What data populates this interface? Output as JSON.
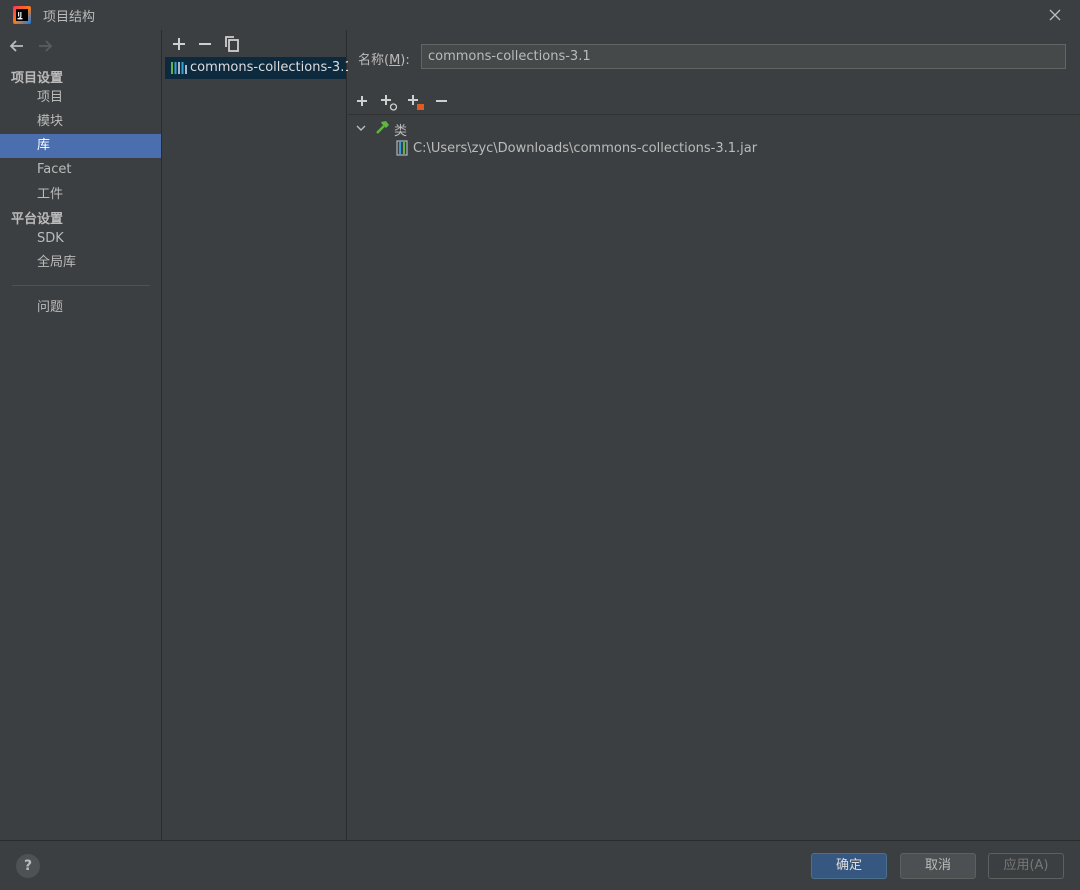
{
  "window": {
    "title": "项目结构",
    "app_icon": "intellij-idea-icon",
    "close_icon": "close-icon"
  },
  "nav": {
    "back_icon": "arrow-left-icon",
    "forward_icon": "arrow-right-icon",
    "project_settings_header": "项目设置",
    "platform_settings_header": "平台设置",
    "items": [
      {
        "label": "项目",
        "selected": false
      },
      {
        "label": "模块",
        "selected": false
      },
      {
        "label": "库",
        "selected": true
      },
      {
        "label": "Facet",
        "selected": false
      },
      {
        "label": "工件",
        "selected": false
      },
      {
        "label": "SDK",
        "selected": false
      },
      {
        "label": "全局库",
        "selected": false
      },
      {
        "label": "问题",
        "selected": false
      }
    ]
  },
  "library_list": {
    "toolbar": [
      "add-icon",
      "remove-icon",
      "copy-icon"
    ],
    "items": [
      {
        "label": "commons-collections-3.1",
        "icon": "library-icon",
        "selected": true
      }
    ]
  },
  "detail": {
    "name_label_prefix": "名称(",
    "name_label_mnemonic": "M",
    "name_label_suffix": "):",
    "name_value": "commons-collections-3.1",
    "toolbar": [
      "add-icon",
      "add-attached-icon",
      "add-jar-icon",
      "remove-icon"
    ],
    "tree": {
      "root_label": "类",
      "root_icon": "classes-hammer-icon",
      "expanded": true,
      "children": [
        {
          "label": "C:\\Users\\zyc\\Downloads\\commons-collections-3.1.jar",
          "icon": "jar-icon"
        }
      ]
    }
  },
  "footer": {
    "help_label": "?",
    "ok_label": "确定",
    "cancel_label": "取消",
    "apply_label": "应用(A)"
  },
  "colors": {
    "background": "#3c3f41",
    "selection": "#4b6eaf",
    "list_selection": "#0d293e",
    "primary_button": "#365880"
  }
}
